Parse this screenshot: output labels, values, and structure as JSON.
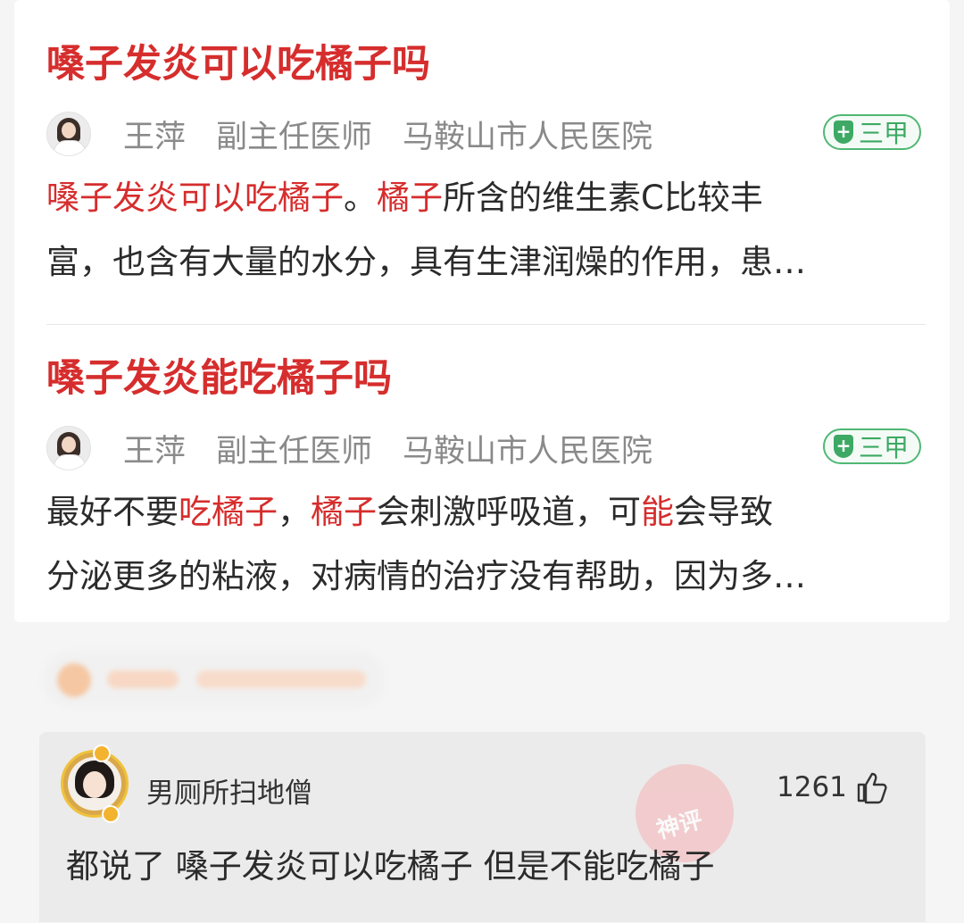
{
  "results": [
    {
      "title": "嗓子发炎可以吃橘子吗",
      "doctor_name": "王萍",
      "doctor_title": "副主任医师",
      "hospital": "马鞍山市人民医院",
      "badge": "三甲",
      "snippet_line1": [
        {
          "text": "嗓子发炎可以吃橘子",
          "hl": true
        },
        {
          "text": "。",
          "hl": false
        },
        {
          "text": "橘子",
          "hl": true
        },
        {
          "text": "所含的维生素C比较丰",
          "hl": false
        }
      ],
      "snippet_line2": "富，也含有大量的水分，具有生津润燥的作用，患…"
    },
    {
      "title": "嗓子发炎能吃橘子吗",
      "doctor_name": "王萍",
      "doctor_title": "副主任医师",
      "hospital": "马鞍山市人民医院",
      "badge": "三甲",
      "snippet_line1": [
        {
          "text": "最好不要",
          "hl": false
        },
        {
          "text": "吃橘子",
          "hl": true
        },
        {
          "text": "，",
          "hl": false
        },
        {
          "text": "橘子",
          "hl": true
        },
        {
          "text": "会刺激呼吸道，可",
          "hl": false
        },
        {
          "text": "能",
          "hl": true
        },
        {
          "text": "会导致",
          "hl": false
        }
      ],
      "snippet_line2": "分泌更多的粘液，对病情的治疗没有帮助，因为多…"
    }
  ],
  "comment": {
    "username": "男厕所扫地僧",
    "likes": "1261",
    "stamp": "神评",
    "text": "都说了 嗓子发炎可以吃橘子 但是不能吃橘子"
  },
  "colors": {
    "highlight": "#d62d2d",
    "badge_green": "#3da964"
  },
  "icons": [
    "doctor-avatar",
    "shield-plus-icon",
    "thumbs-up-icon",
    "user-avatar"
  ]
}
